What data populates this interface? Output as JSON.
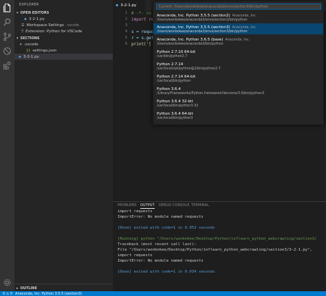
{
  "sidebar": {
    "title": "EXPLORER",
    "open_editors": {
      "header": "OPEN EDITORS",
      "items": [
        {
          "label": "3-2-1.py",
          "desc": ""
        },
        {
          "label": "Workspace Settings",
          "desc": ".vscode"
        },
        {
          "label": "Extension: Python for VSCode",
          "desc": ""
        }
      ]
    },
    "sections": {
      "header": "SECTIONS",
      "items": [
        {
          "label": ".vscode"
        },
        {
          "label": "settings.json"
        },
        {
          "label": "3-2-1.py"
        }
      ]
    },
    "outline_header": "OUTLINE"
  },
  "editor": {
    "tab_label": "3-2-1.py",
    "lines": [
      {
        "num": "1",
        "text": "# -*- co"
      },
      {
        "num": "2",
        "text": "import re"
      },
      {
        "num": "3",
        "text": ""
      },
      {
        "num": "4",
        "text": "s = reque"
      },
      {
        "num": "5",
        "text": "r = s.get"
      },
      {
        "num": "6",
        "text": "print('["
      }
    ]
  },
  "quickpick": {
    "placeholder": "Current: /Users/wonbokee/anaconda3/envs/section3/bin/python",
    "items": [
      {
        "label": "Anaconda, Inc. Python 3.5.5 (section2)",
        "desc": "Anaconda, Inc.",
        "detail": "/Users/wonbokee/anaconda3/envs/section2/bin/python"
      },
      {
        "label": "Anaconda, Inc. Python 3.5.5 (section3)",
        "desc": "Anaconda, Inc.",
        "detail": "/Users/wonbokee/anaconda3/envs/section3/bin/python"
      },
      {
        "label": "Anaconda, Inc. Python 3.6.5 (base)",
        "desc": "Anaconda, Inc.",
        "detail": "/Users/wonbokee/anaconda3/bin/python"
      },
      {
        "label": "Python 2.7.10 64-bit",
        "desc": "",
        "detail": "/usr/bin/python2.7"
      },
      {
        "label": "Python 2.7.14",
        "desc": "",
        "detail": "/usr/local/opt/python@2/bin/python2.7"
      },
      {
        "label": "Python 2.7.14 64-bit",
        "desc": "",
        "detail": "/usr/local/bin/python"
      },
      {
        "label": "Python 3.6.4",
        "desc": "",
        "detail": "/Library/Frameworks/Python.framework/Versions/3.6/bin/python3"
      },
      {
        "label": "Python 3.6.4 32-bit",
        "desc": "",
        "detail": "/usr/local/bin/python3-32"
      },
      {
        "label": "Python 3.6.4 64-bit",
        "desc": "",
        "detail": "/usr/local/bin/python3"
      }
    ]
  },
  "panel": {
    "tabs": [
      "PROBLEMS",
      "OUTPUT",
      "DEBUG CONSOLE",
      "TERMINAL"
    ],
    "output": [
      {
        "kind": "err",
        "text": "import requests"
      },
      {
        "kind": "err",
        "text": "ImportError: No module named requests"
      },
      {
        "kind": "blank",
        "text": ""
      },
      {
        "kind": "done",
        "text": "[Done] exited with code=1 in 0.053 seconds"
      },
      {
        "kind": "blank",
        "text": ""
      },
      {
        "kind": "running",
        "text": "[Running] python \"/Users/wonbokee/Desktop/Python/inflearn_python_webcrawling/section3/"
      },
      {
        "kind": "err",
        "text": "Traceback (most recent call last):"
      },
      {
        "kind": "err",
        "text": "  File \"/Users/wonbokee/Desktop/Python/inflearn_python_webcrawling/section3/3-2-1.py\","
      },
      {
        "kind": "err",
        "text": "    import requests"
      },
      {
        "kind": "err",
        "text": "ImportError: No module named requests"
      },
      {
        "kind": "blank",
        "text": ""
      },
      {
        "kind": "done",
        "text": "[Done] exited with code=1 in 0.034 seconds"
      }
    ]
  },
  "status": {
    "problems": "0 ⚠ 0",
    "interpreter": "Anaconda, Inc. Python 3.5.5 (section3)"
  },
  "colors": {
    "accent": "#007acc",
    "selection": "#094771"
  }
}
